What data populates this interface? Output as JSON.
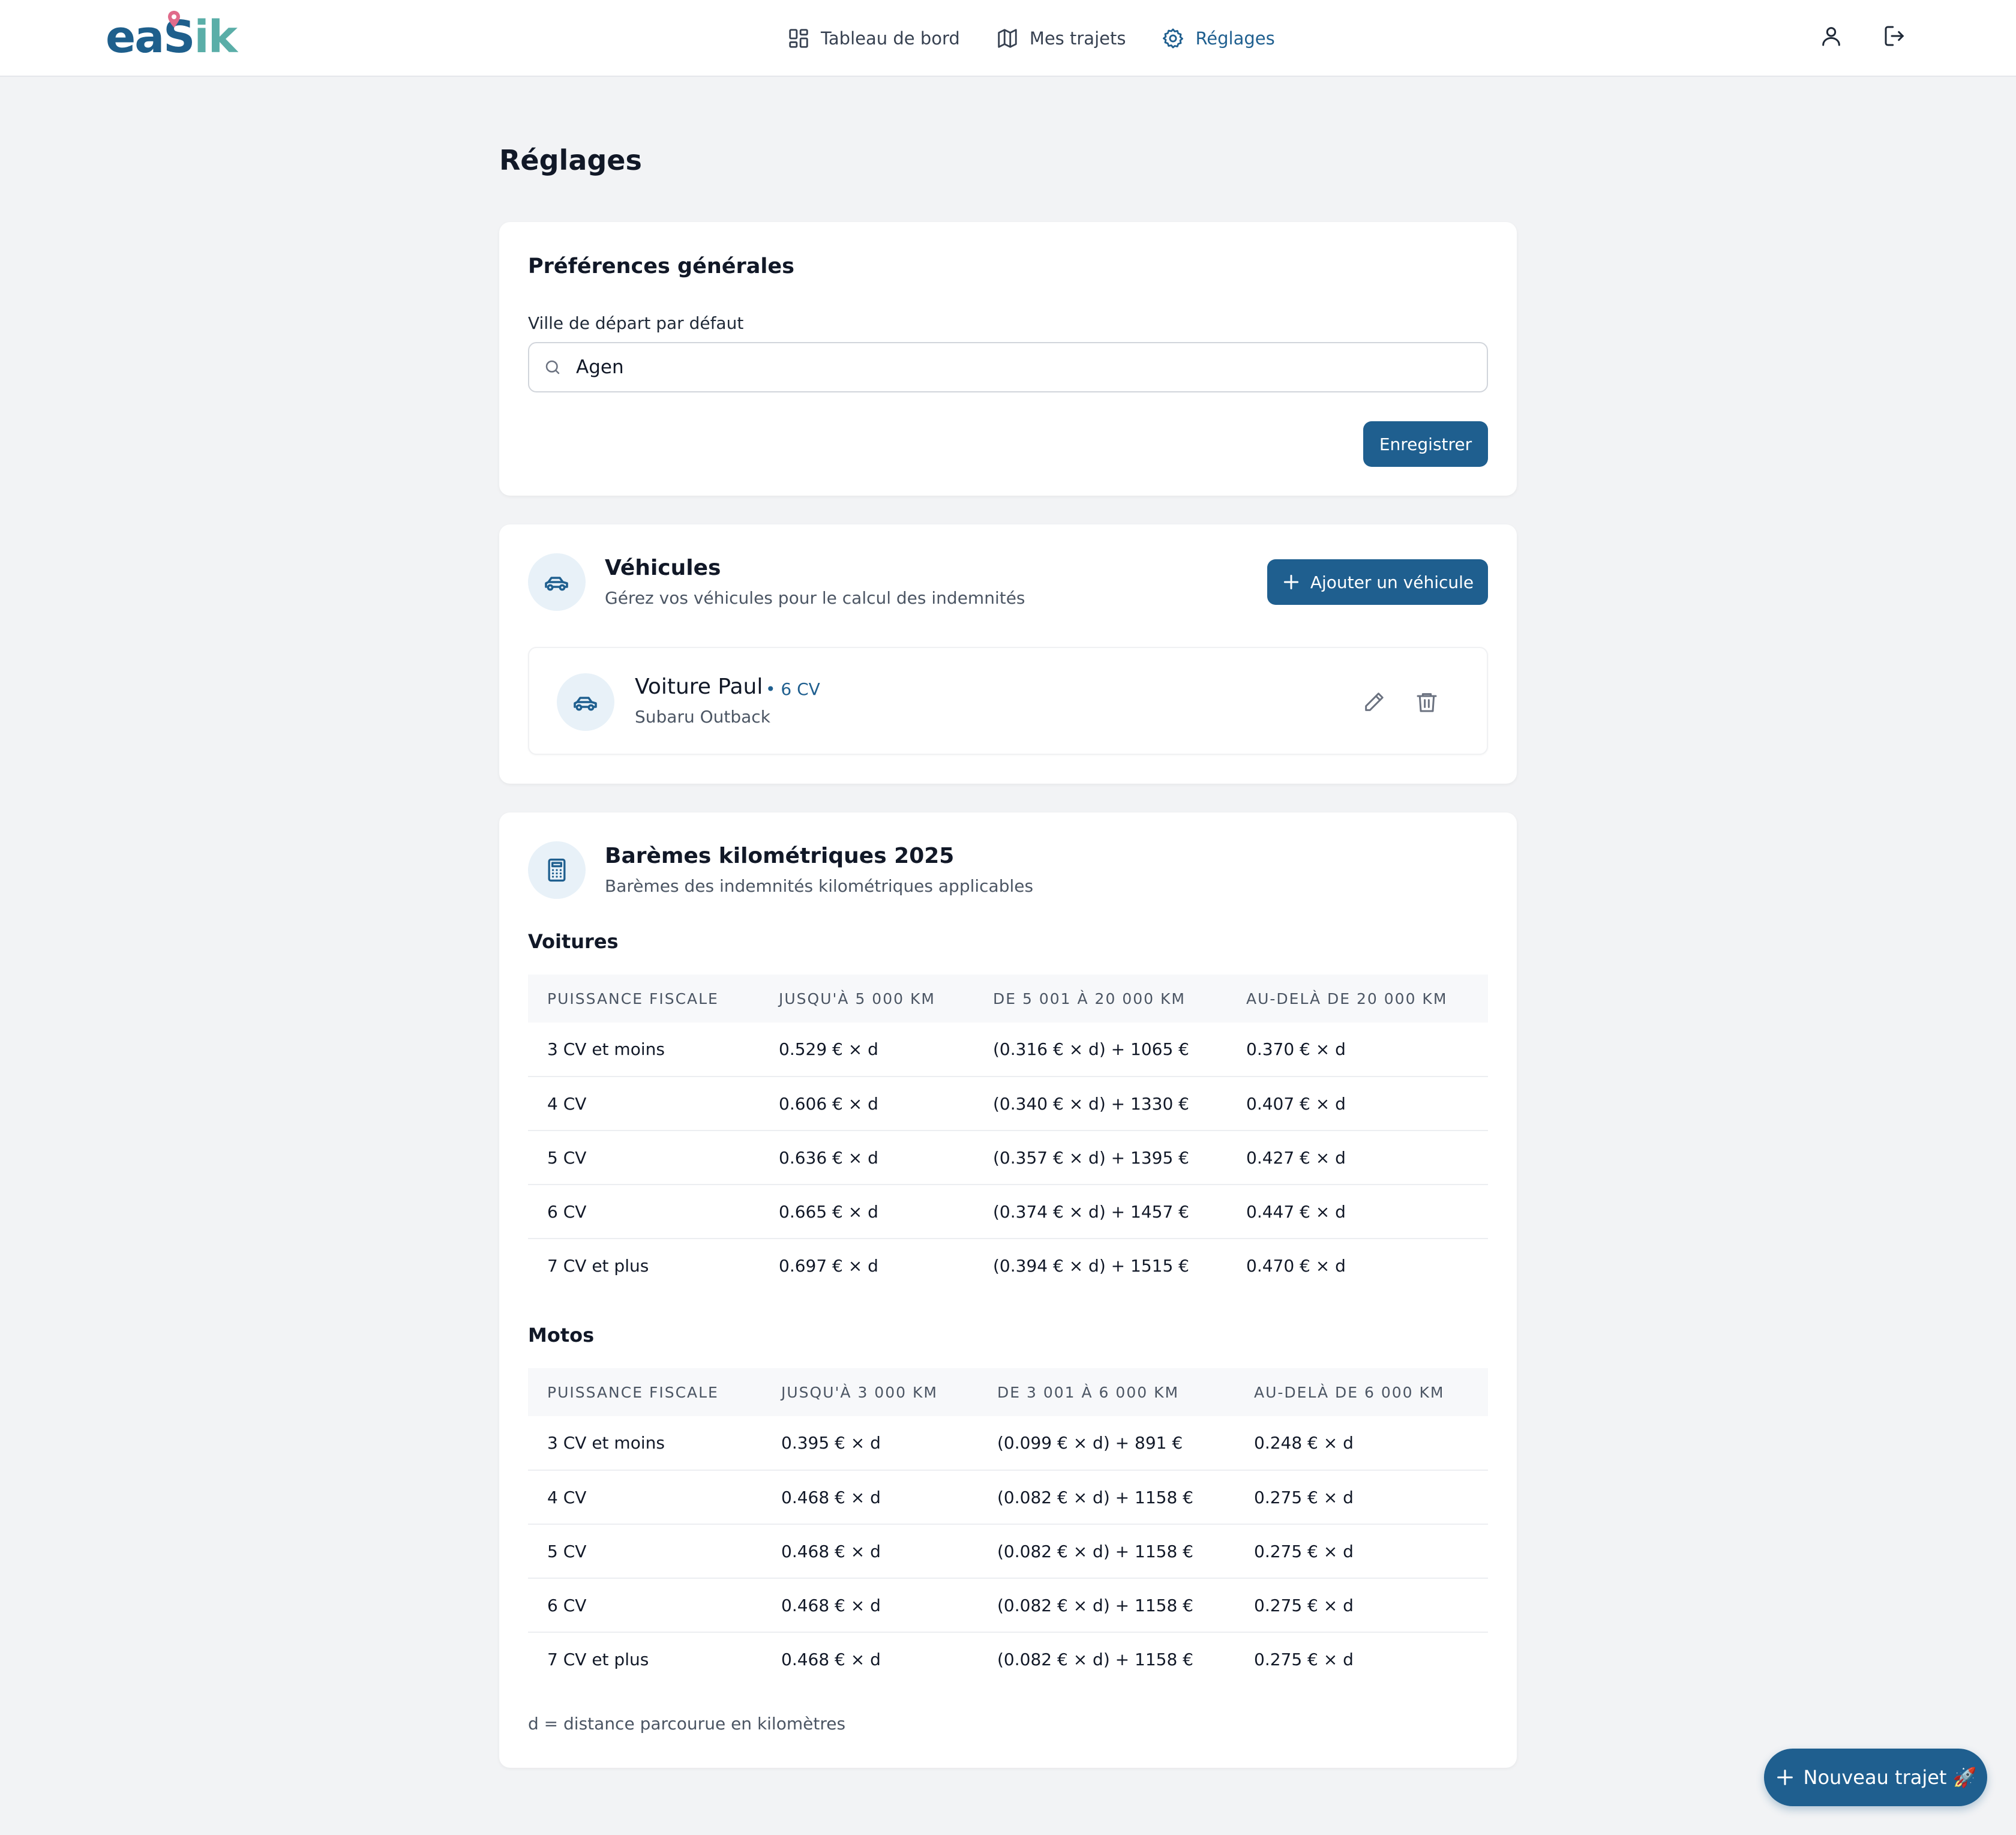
{
  "header": {
    "logo": {
      "part1": "ea",
      "part2": "S",
      "part3": "ik"
    },
    "nav": [
      {
        "label": "Tableau de bord",
        "icon": "dashboard-icon"
      },
      {
        "label": "Mes trajets",
        "icon": "map-icon"
      },
      {
        "label": "Réglages",
        "icon": "gear-icon",
        "active": true
      }
    ],
    "icons": [
      "user-icon",
      "logout-icon"
    ]
  },
  "page": {
    "title": "Réglages"
  },
  "preferences": {
    "title": "Préférences générales",
    "city_label": "Ville de départ par défaut",
    "city_value": "Agen",
    "save_label": "Enregistrer"
  },
  "vehicles": {
    "title": "Véhicules",
    "subtitle": "Gérez vos véhicules pour le calcul des indemnités",
    "add_label": "Ajouter un véhicule",
    "items": [
      {
        "name": "Voiture Paul",
        "cv": "• 6 CV",
        "model": "Subaru Outback"
      }
    ]
  },
  "rates": {
    "title": "Barèmes kilométriques 2025",
    "subtitle": "Barèmes des indemnités kilométriques applicables",
    "cars": {
      "label": "Voitures",
      "headers": [
        "PUISSANCE FISCALE",
        "JUSQU'À 5 000 KM",
        "DE 5 001 À 20 000 KM",
        "AU-DELÀ DE 20 000 KM"
      ],
      "rows": [
        [
          "3 CV et moins",
          "0.529 € × d",
          "(0.316 € × d) + 1065 €",
          "0.370 € × d"
        ],
        [
          "4 CV",
          "0.606 € × d",
          "(0.340 € × d) + 1330 €",
          "0.407 € × d"
        ],
        [
          "5 CV",
          "0.636 € × d",
          "(0.357 € × d) + 1395 €",
          "0.427 € × d"
        ],
        [
          "6 CV",
          "0.665 € × d",
          "(0.374 € × d) + 1457 €",
          "0.447 € × d"
        ],
        [
          "7 CV et plus",
          "0.697 € × d",
          "(0.394 € × d) + 1515 €",
          "0.470 € × d"
        ]
      ]
    },
    "motos": {
      "label": "Motos",
      "headers": [
        "PUISSANCE FISCALE",
        "JUSQU'À 3 000 KM",
        "DE 3 001 À 6 000 KM",
        "AU-DELÀ DE 6 000 KM"
      ],
      "rows": [
        [
          "3 CV et moins",
          "0.395 € × d",
          "(0.099 € × d) + 891 €",
          "0.248 € × d"
        ],
        [
          "4 CV",
          "0.468 € × d",
          "(0.082 € × d) + 1158 €",
          "0.275 € × d"
        ],
        [
          "5 CV",
          "0.468 € × d",
          "(0.082 € × d) + 1158 €",
          "0.275 € × d"
        ],
        [
          "6 CV",
          "0.468 € × d",
          "(0.082 € × d) + 1158 €",
          "0.275 € × d"
        ],
        [
          "7 CV et plus",
          "0.468 € × d",
          "(0.082 € × d) + 1158 €",
          "0.275 € × d"
        ]
      ]
    },
    "footnote": "d = distance parcourue en kilomètres"
  },
  "fab": {
    "label": "Nouveau trajet 🚀"
  },
  "colors": {
    "primary": "#1f5f8f",
    "logo_teal": "#5aaea8",
    "background": "#f2f3f5"
  }
}
